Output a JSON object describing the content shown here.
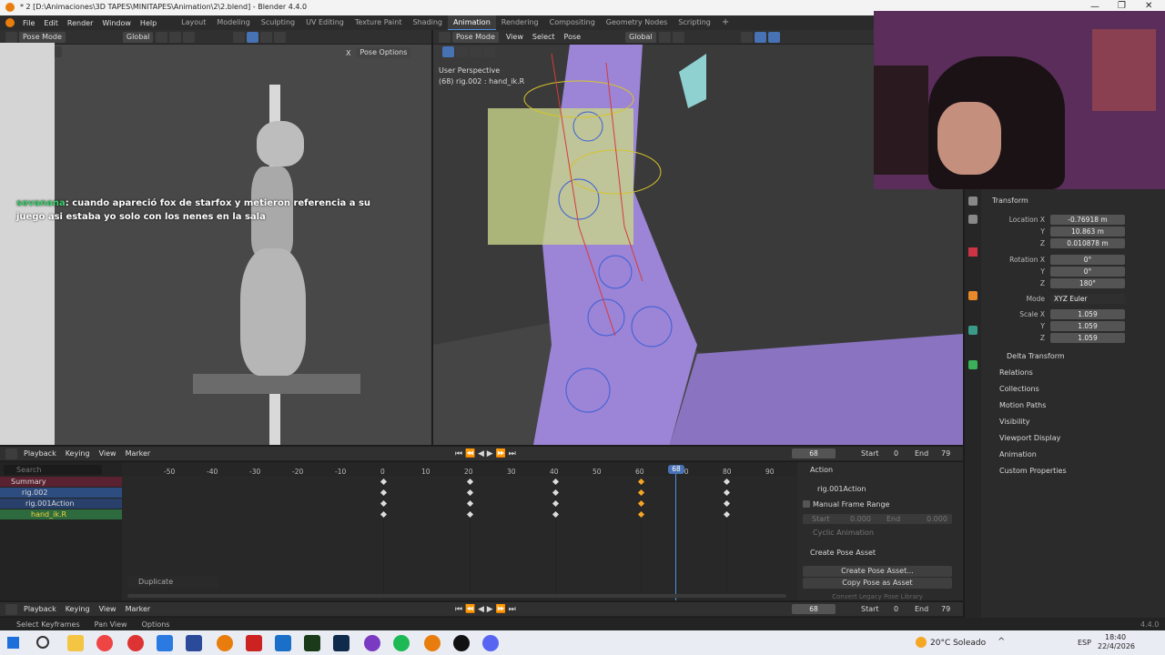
{
  "title": "* 2 [D:\\Animaciones\\3D TAPES\\MINITAPES\\Animation\\2\\2.blend] - Blender 4.4.0",
  "menus": [
    "File",
    "Edit",
    "Render",
    "Window",
    "Help"
  ],
  "workspaces": [
    "Layout",
    "Modeling",
    "Sculpting",
    "UV Editing",
    "Texture Paint",
    "Shading",
    "Animation",
    "Rendering",
    "Compositing",
    "Geometry Nodes",
    "Scripting"
  ],
  "active_workspace": "Animation",
  "left_view": {
    "mode": "Pose Mode",
    "orient": "Global",
    "pose_options": "Pose Options",
    "x_label": "X"
  },
  "chat": {
    "user": "sevanana",
    "sep": ":",
    "message": " cuando apareció fox de starfox y metieron referencia a su juego asi estaba yo solo con los nenes en la sala"
  },
  "right_view": {
    "mode": "Pose Mode",
    "menus": [
      "View",
      "Select",
      "Pose"
    ],
    "orient": "Global",
    "persp": "User Perspective",
    "object": "(68) rig.002 : hand_ik.R"
  },
  "props": {
    "transform": "Transform",
    "location_label": "Location X",
    "loc_x": "-0.76918 m",
    "loc_y": "10.863 m",
    "loc_z": "0.010878 m",
    "rotation_label": "Rotation X",
    "rot_x": "0°",
    "rot_y": "0°",
    "rot_z": "180°",
    "mode_label": "Mode",
    "mode_value": "XYZ Euler",
    "scale_label": "Scale X",
    "scale_x": "1.059",
    "scale_y": "1.059",
    "scale_z": "1.059",
    "y": "Y",
    "z": "Z",
    "delta": "Delta Transform",
    "sections": [
      "Relations",
      "Collections",
      "Motion Paths",
      "Visibility",
      "Viewport Display",
      "Animation",
      "Custom Properties"
    ]
  },
  "timeline": {
    "playback": "Playback",
    "keying": "Keying",
    "view": "View",
    "marker": "Marker",
    "frame": "68",
    "start_label": "Start",
    "start": "0",
    "end_label": "End",
    "end": "79"
  },
  "dope": {
    "search": "Search",
    "ticks": [
      "-50",
      "-40",
      "-30",
      "-20",
      "-10",
      "0",
      "10",
      "20",
      "30",
      "40",
      "50",
      "60",
      "70",
      "80",
      "90"
    ],
    "current": "68",
    "channels": [
      "Summary",
      "rig.002",
      "rig.001Action",
      "hand_ik.R"
    ],
    "duplicate": "Duplicate"
  },
  "action_panel": {
    "title": "Action",
    "action": "rig.001Action",
    "manual": "Manual Frame Range",
    "start_label": "Start",
    "start_val": "0.000",
    "end_label": "End",
    "end_val": "0.000",
    "cyclic": "Cyclic Animation",
    "pose_title": "Create Pose Asset",
    "create_btn": "Create Pose Asset...",
    "copy_btn": "Copy Pose as Asset",
    "convert": "Convert Legacy Pose Library"
  },
  "status": {
    "select": "Select Keyframes",
    "pan": "Pan View",
    "options": "Options",
    "version": "4.4.0"
  },
  "taskbar": {
    "weather": "20°C Soleado",
    "lang": "ESP",
    "time": "18:40",
    "date": "22/4/2026"
  }
}
